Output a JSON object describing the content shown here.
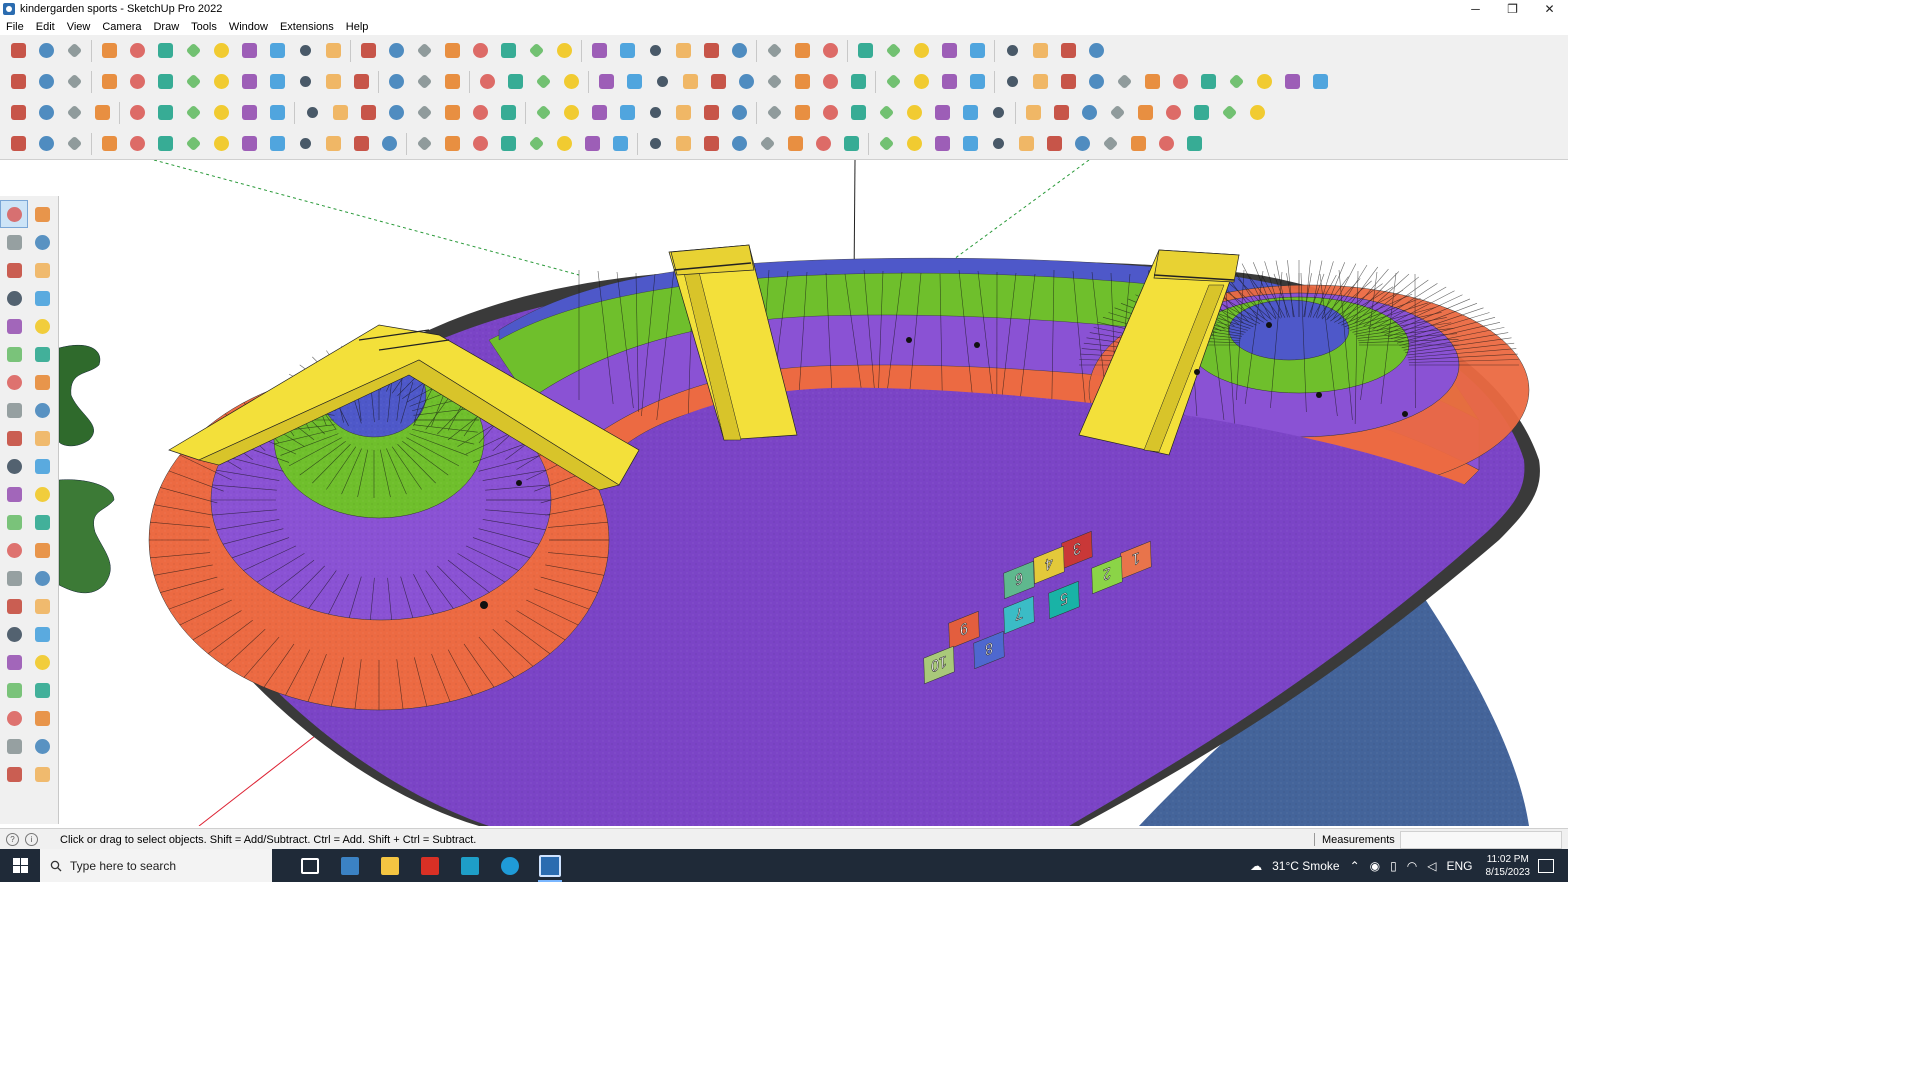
{
  "window": {
    "title": "kindergarden sports - SketchUp Pro 2022",
    "minimize": "─",
    "restore": "❐",
    "close": "✕"
  },
  "menu": [
    "File",
    "Edit",
    "View",
    "Camera",
    "Draw",
    "Tools",
    "Window",
    "Extensions",
    "Help"
  ],
  "model": {
    "hopscotch": [
      "1",
      "2",
      "3",
      "4",
      "5",
      "6",
      "7",
      "8",
      "9",
      "10"
    ]
  },
  "colors": {
    "purple_floor": "#7b44c6",
    "orange_ring": "#ec6a42",
    "green_ring": "#6fbf2c",
    "blue_ring": "#4e58c9",
    "slide_yellow": "#f3e03a",
    "border_grey": "#3a3a3a",
    "water_blue": "#44649a"
  },
  "status": {
    "hint": "Click or drag to select objects. Shift = Add/Subtract. Ctrl = Add. Shift + Ctrl = Subtract.",
    "measurements_label": "Measurements"
  },
  "taskbar": {
    "search_placeholder": "Type here to search",
    "weather": "31°C Smoke",
    "language": "ENG",
    "time": "11:02 PM",
    "date": "8/15/2023"
  }
}
